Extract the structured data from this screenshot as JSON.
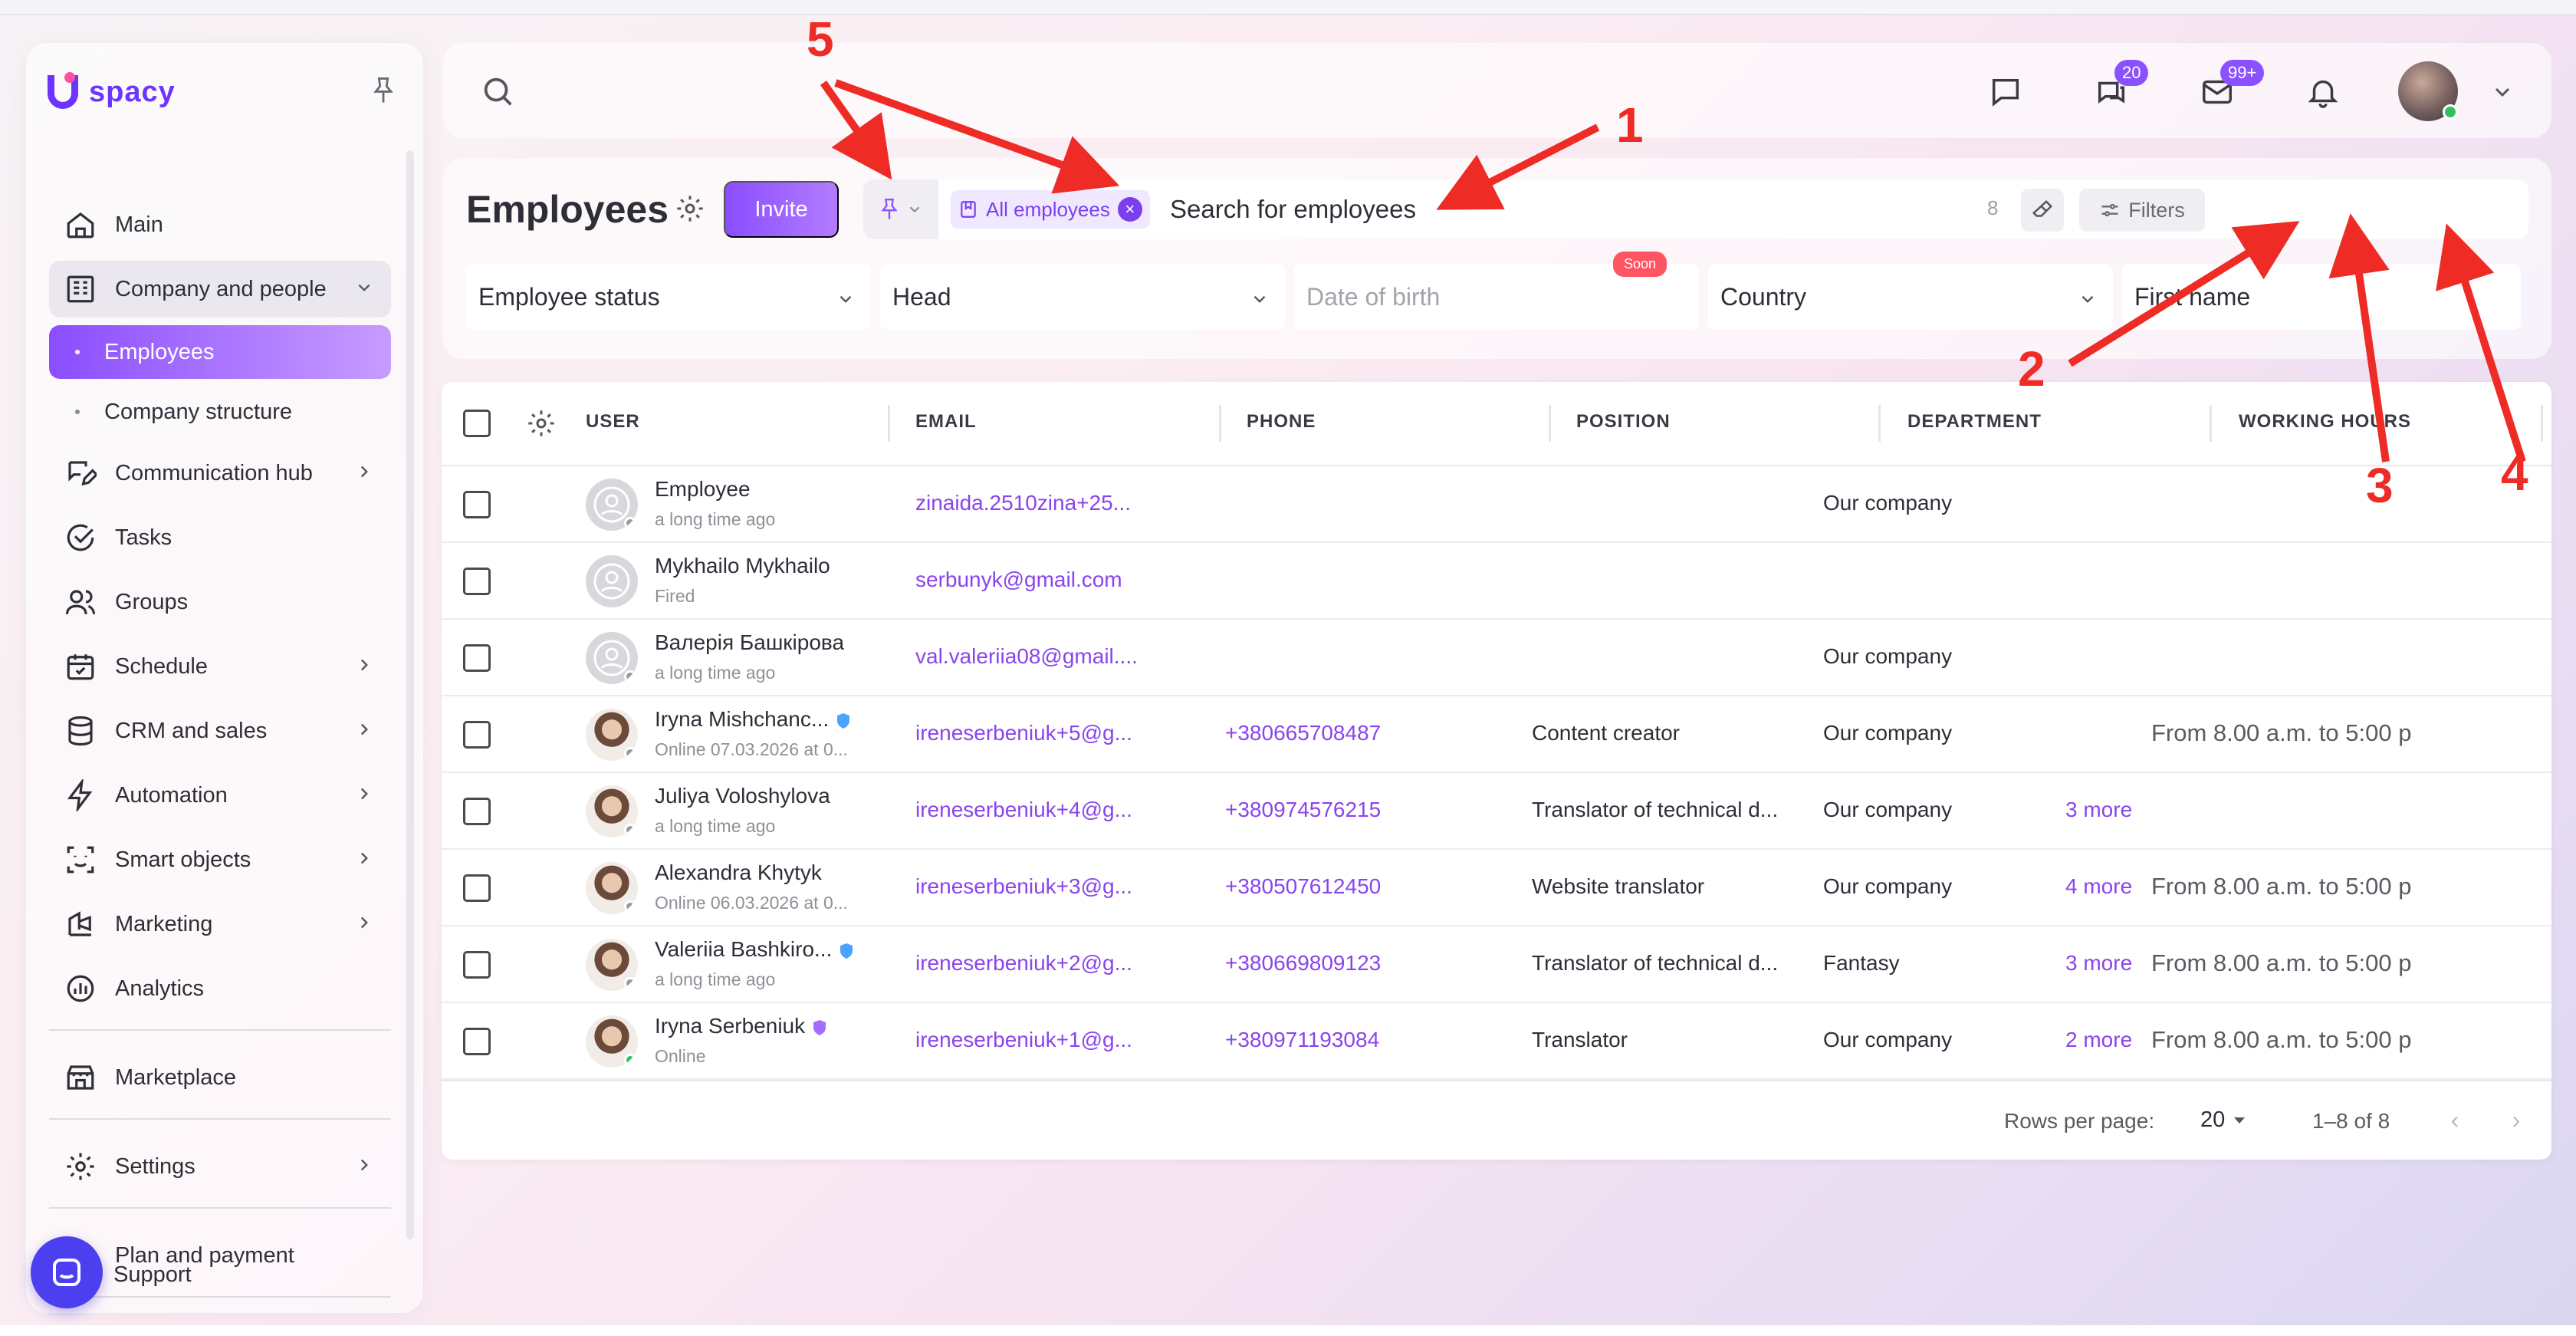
{
  "app": {
    "logo_text": "spacy",
    "brand_color": "#6b35ff",
    "accent_color": "#8a4dff"
  },
  "sidebar": {
    "items": [
      {
        "label": "Main",
        "icon": "home-icon"
      },
      {
        "label": "Company and people",
        "icon": "building-icon",
        "expanded": true,
        "children": [
          {
            "label": "Employees",
            "active": true
          },
          {
            "label": "Company structure"
          }
        ]
      },
      {
        "label": "Communication hub",
        "icon": "chat-edit-icon"
      },
      {
        "label": "Tasks",
        "icon": "check-circle-icon"
      },
      {
        "label": "Groups",
        "icon": "users-icon"
      },
      {
        "label": "Schedule",
        "icon": "calendar-icon"
      },
      {
        "label": "CRM and sales",
        "icon": "database-icon"
      },
      {
        "label": "Automation",
        "icon": "lightning-icon"
      },
      {
        "label": "Smart objects",
        "icon": "scan-icon"
      },
      {
        "label": "Marketing",
        "icon": "marketing-icon"
      },
      {
        "label": "Analytics",
        "icon": "analytics-icon"
      }
    ],
    "marketplace": "Marketplace",
    "settings": "Settings",
    "plan": "Plan and payment",
    "support": "Support"
  },
  "topbar": {
    "chat_badge": "20",
    "mail_badge": "99+"
  },
  "employees": {
    "title": "Employees",
    "invite_label": "Invite",
    "chip_label": "All employees",
    "search_placeholder": "Search for employees",
    "result_count": "8",
    "filters_label": "Filters",
    "filter_fields": [
      {
        "label": "Employee status",
        "placeholder": false
      },
      {
        "label": "Head",
        "placeholder": false
      },
      {
        "label": "Date of birth",
        "placeholder": true,
        "badge": "Soon"
      },
      {
        "label": "Country",
        "placeholder": false
      },
      {
        "label": "First name",
        "placeholder": false
      }
    ]
  },
  "table": {
    "columns": [
      "USER",
      "EMAIL",
      "PHONE",
      "POSITION",
      "DEPARTMENT",
      "WORKING HOURS"
    ],
    "rows": [
      {
        "name": "Employee",
        "sub": "a long time ago",
        "email": "zinaida.2510zina+25...",
        "phone": "",
        "position": "",
        "department": "Our company",
        "more": "",
        "hours": "",
        "photo": false,
        "online": false,
        "shield": ""
      },
      {
        "name": "Mykhailo Mykhailo",
        "sub": "Fired",
        "email": "serbunyk@gmail.com",
        "phone": "",
        "position": "",
        "department": "",
        "more": "",
        "hours": "",
        "photo": false,
        "online": false,
        "shield": "",
        "no_dot": true
      },
      {
        "name": "Валерія Башкірова",
        "sub": "a long time ago",
        "email": "val.valeriia08@gmail....",
        "phone": "",
        "position": "",
        "department": "Our company",
        "more": "",
        "hours": "",
        "photo": false,
        "online": false,
        "shield": ""
      },
      {
        "name": "Iryna Mishchanc...",
        "sub": "Online 07.03.2026 at 0...",
        "email": "ireneserbeniuk+5@g...",
        "phone": "+380665708487",
        "position": "Content creator",
        "department": "Our company",
        "more": "",
        "hours": "From 8.00 a.m. to 5:00 p",
        "photo": true,
        "online": false,
        "shield": "blue"
      },
      {
        "name": "Juliya Voloshylova",
        "sub": "a long time ago",
        "email": "ireneserbeniuk+4@g...",
        "phone": "+380974576215",
        "position": "Translator of technical d...",
        "department": "Our company",
        "more": "3 more",
        "hours": "",
        "photo": true,
        "online": false,
        "shield": ""
      },
      {
        "name": "Alexandra Khytyk",
        "sub": "Online 06.03.2026 at 0...",
        "email": "ireneserbeniuk+3@g...",
        "phone": "+380507612450",
        "position": "Website translator",
        "department": "Our company",
        "more": "4 more",
        "hours": "From 8.00 a.m. to 5:00 p",
        "photo": true,
        "online": false,
        "shield": ""
      },
      {
        "name": "Valeriia Bashkiro...",
        "sub": "a long time ago",
        "email": "ireneserbeniuk+2@g...",
        "phone": "+380669809123",
        "position": "Translator of technical d...",
        "department": "Fantasy",
        "more": "3 more",
        "hours": "From 8.00 a.m. to 5:00 p",
        "photo": true,
        "online": false,
        "shield": "blue"
      },
      {
        "name": "Iryna Serbeniuk",
        "sub": "Online",
        "email": "ireneserbeniuk+1@g...",
        "phone": "+380971193084",
        "position": "Translator",
        "department": "Our company",
        "more": "2 more",
        "hours": "From 8.00 a.m. to 5:00 p",
        "photo": true,
        "online": true,
        "shield": "purple"
      }
    ],
    "footer": {
      "rows_per_page_label": "Rows per page:",
      "rows_per_page_value": "20",
      "range": "1–8 of 8"
    }
  },
  "annotations": [
    "5",
    "1",
    "2",
    "3",
    "4"
  ]
}
